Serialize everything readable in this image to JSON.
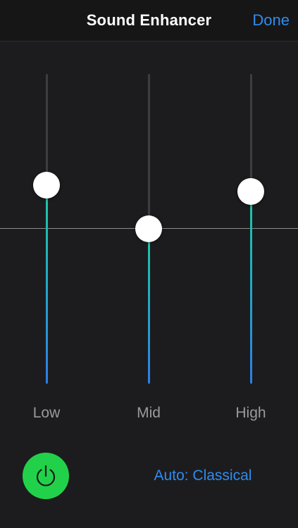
{
  "header": {
    "title": "Sound Enhancer",
    "done_label": "Done"
  },
  "equalizer": {
    "bands": [
      {
        "label": "Low",
        "level": 0.64
      },
      {
        "label": "Mid",
        "level": 0.5
      },
      {
        "label": "High",
        "level": 0.62
      }
    ]
  },
  "footer": {
    "power_icon": "power-icon",
    "power_on": true,
    "preset_label": "Auto: Classical"
  },
  "colors": {
    "accent": "#2f8cf0",
    "power_on": "#22d14a",
    "track_fill_top": "#1fc9a0",
    "track_fill_bottom": "#2f7de8"
  }
}
